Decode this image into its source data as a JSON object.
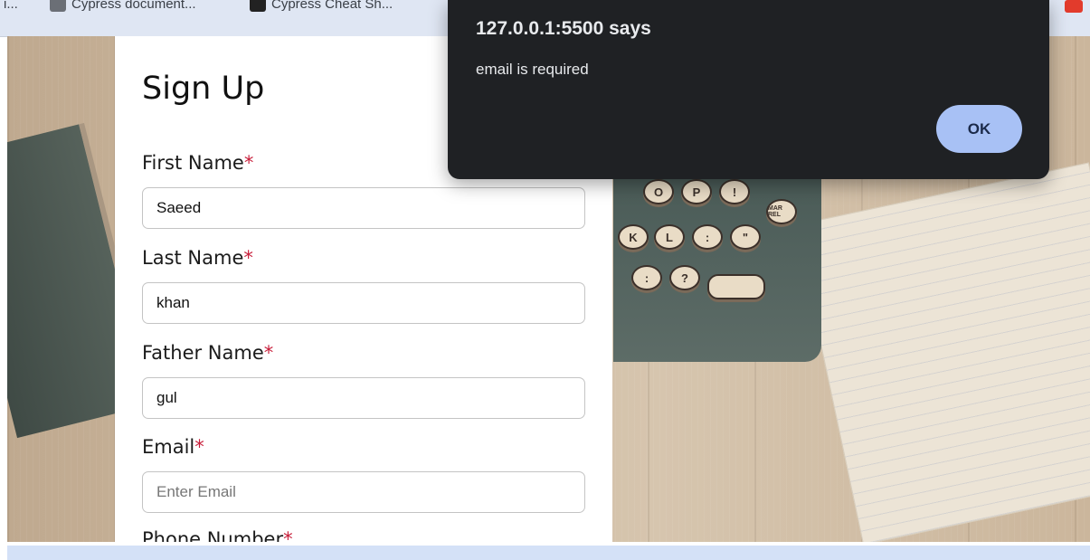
{
  "bookmarks": {
    "items": [
      {
        "label": "i..."
      },
      {
        "label": "Cypress document..."
      },
      {
        "label": "Cypress Cheat Sh..."
      }
    ]
  },
  "form": {
    "title": "Sign Up",
    "required_mark": "*",
    "fields": {
      "first_name": {
        "label": "First Name",
        "value": "Saeed"
      },
      "last_name": {
        "label": "Last Name",
        "value": "khan"
      },
      "father_name": {
        "label": "Father Name",
        "value": "gul"
      },
      "email": {
        "label": "Email",
        "value": "",
        "placeholder": "Enter Email"
      },
      "phone": {
        "label": "Phone Number"
      }
    }
  },
  "background": {
    "keys": [
      "O",
      "P",
      "!",
      "MAR REL",
      "K",
      "L",
      ":",
      "\"",
      ":",
      "?",
      ""
    ]
  },
  "dialog": {
    "title": "127.0.0.1:5500 says",
    "message": "email is required",
    "ok_label": "OK"
  },
  "colors": {
    "required": "#c81e3a",
    "dialog_bg": "#1f2124",
    "ok_button": "#a8c1f5"
  }
}
